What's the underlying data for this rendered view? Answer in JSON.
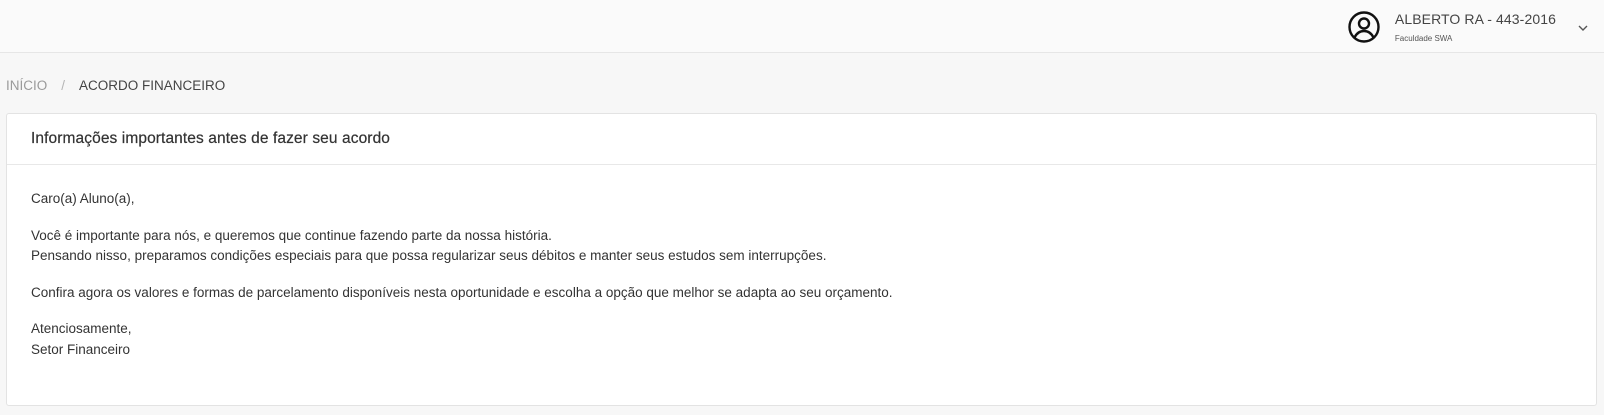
{
  "header": {
    "user_name": "ALBERTO RA - 443-2016",
    "institution": "Faculdade SWA",
    "avatar_icon": "account-circle-icon",
    "dropdown_icon": "chevron-down-icon"
  },
  "breadcrumb": {
    "home": "INÍCIO",
    "separator": "/",
    "current": "ACORDO FINANCEIRO"
  },
  "card": {
    "title": "Informações importantes antes de fazer seu acordo",
    "greeting": "Caro(a) Aluno(a),",
    "paragraph1_line1": "Você é importante para nós, e queremos que continue fazendo parte da nossa história.",
    "paragraph1_line2": "Pensando nisso, preparamos condições especiais para que possa regularizar seus débitos e manter seus estudos sem interrupções.",
    "paragraph2": "Confira agora os valores e formas de parcelamento disponíveis nesta oportunidade e escolha a opção que melhor se adapta ao seu orçamento.",
    "closing": "Atenciosamente,",
    "signature": "Setor Financeiro"
  }
}
